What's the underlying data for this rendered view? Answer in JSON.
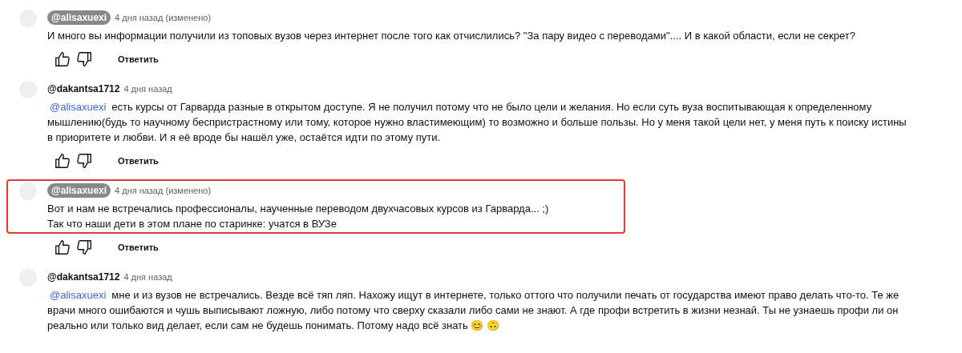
{
  "comments": [
    {
      "author": "@alisaxuexi",
      "author_highlighted": true,
      "time": "4 дня назад (изменено)",
      "highlighted": false,
      "lines": [
        "И много вы информации получили из топовых вузов через интернет после того как отчислились? \"За пару видео с переводами\".... И в какой области, если не секрет?"
      ],
      "reply": "Ответить"
    },
    {
      "author": "@dakantsa1712",
      "author_highlighted": false,
      "time": "4 дня назад",
      "highlighted": false,
      "mention": "@alisaxuexi",
      "lines": [
        "есть курсы от Гарварда разные в открытом доступе. Я не получил потому что не было цели и желания. Но если суть вуза воспитывающая к определенному",
        "мышлению(будь то научному беспристрастному или тому, которое нужно властимеющим) то возможно и больше пользы. Но у меня такой цели нет, у меня путь к поиску истины",
        "в приоритете и любви. И я её вроде бы нашёл уже, остаётся идти по этому пути."
      ],
      "reply": "Ответить"
    },
    {
      "author": "@alisaxuexi",
      "author_highlighted": true,
      "time": "4 дня назад (изменено)",
      "highlighted": true,
      "lines": [
        "Вот и нам не встречались профессионалы, наученные переводом двухчасовых курсов из Гарварда... ;)",
        "Так что наши дети в этом плане по старинке: учатся в ВУЗе"
      ],
      "reply": "Ответить"
    },
    {
      "author": "@dakantsa1712",
      "author_highlighted": false,
      "time": "4 дня назад",
      "highlighted": false,
      "mention": "@alisaxuexi",
      "lines": [
        "мне и из вузов не встречались. Везде всё тяп ляп. Нахожу ищут в интернете, только оттого что получили печать от государства имеют право делать что-то. Те же",
        "врачи много ошибаются и чушь выписывают ложную, либо потому что сверху сказали либо сами не знают. А где профи встретить в жизни незнай. Ты не узнаешь профи ли он",
        "реально или только вид делает, если сам не будешь понимать. Потому надо всё знать 😊 🙃"
      ]
    }
  ]
}
